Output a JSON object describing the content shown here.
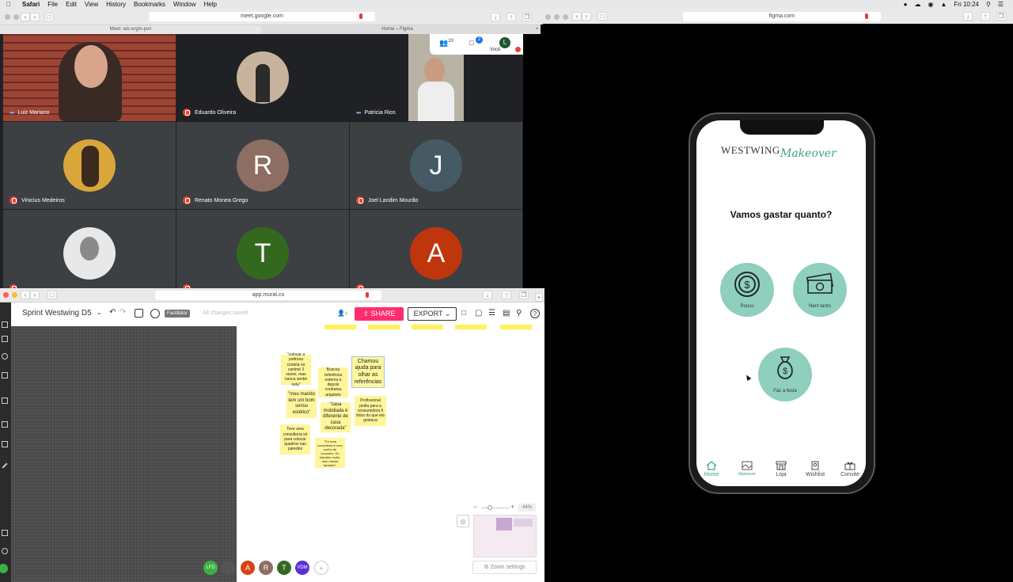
{
  "menubar": {
    "apple": "",
    "items": [
      "Safari",
      "File",
      "Edit",
      "View",
      "History",
      "Bookmarks",
      "Window",
      "Help"
    ],
    "clock": "Fri 10:24"
  },
  "meet_browser": {
    "url": "meet.google.com",
    "tabs": [
      "Meet: wiz-ergm-pvn",
      "Home – Figma"
    ]
  },
  "figma_browser": {
    "url": "figma.com"
  },
  "mural_browser": {
    "url": "app.mural.co"
  },
  "meet": {
    "people_count": "10",
    "chat_count": "2",
    "self_initial": "L",
    "self_label": "Você",
    "participants": [
      {
        "name": "Luiz Mariano",
        "status": "speaking"
      },
      {
        "name": "Eduardo Oliveira",
        "status": "muted"
      },
      {
        "name": "Patricia Rios",
        "status": "speaking"
      },
      {
        "name": "Vinicius Medeiros",
        "status": "muted"
      },
      {
        "name": "Renato Monea Grego",
        "status": "muted",
        "initial": "R",
        "color": "#8d6e63"
      },
      {
        "name": "Joel Landim Mourão",
        "status": "muted",
        "initial": "J",
        "color": "#455a64"
      },
      {
        "name": "",
        "status": "muted"
      },
      {
        "name": "",
        "status": "muted",
        "initial": "T",
        "color": "#33691e"
      },
      {
        "name": "",
        "status": "muted",
        "initial": "A",
        "color": "#bf360c"
      }
    ]
  },
  "mural": {
    "board_title": "Sprint Westwing D5",
    "facilitator_label": "Facilitator",
    "save_status": "All changes saved",
    "viewer_count": "6",
    "share_label": "SHARE",
    "export_label": "EXPORT",
    "zoom_level": "44%",
    "zoom_settings_label": "Zoom settings",
    "collaborators": [
      {
        "initials": "LFD",
        "color": "#3db042"
      },
      {
        "initials": "A",
        "color": "#d84315"
      },
      {
        "initials": "R",
        "color": "#8d6e63"
      },
      {
        "initials": "T",
        "color": "#33691e"
      },
      {
        "initials": "VDM",
        "color": "#5b2fd9"
      }
    ],
    "stickies": [
      "\"colocar a poltrona costela no canimé 3 vezes, mas nunca sentei nela\"",
      "Buscou referência externa e depois contratou arquiteto",
      "Chamou ajuda para olhar as referências",
      "\"meu marido tem um bom senso estético\"",
      "Profissional pediu para a consumidora fi fotos do que ela gostava",
      "\"casa mobiliada é diferente de casa decorada\"",
      "Teve uma consultoria só para colocar quadros nas paredes",
      "\"Tor uma consultoria é meu sonho de consumo. Eu trabalho muito, meu marido também\""
    ]
  },
  "app": {
    "brand": "WESTWING",
    "brand_script": "Makeover",
    "question": "Vamos gastar quanto?",
    "options": [
      "Pouco",
      "Nem tanto",
      "Faz a festa"
    ],
    "tabs": [
      "Home",
      "Makeover",
      "Loja",
      "Wishlist",
      "Convite"
    ],
    "accent": "#8ecfbd",
    "accent_dark": "#3aa38a"
  }
}
